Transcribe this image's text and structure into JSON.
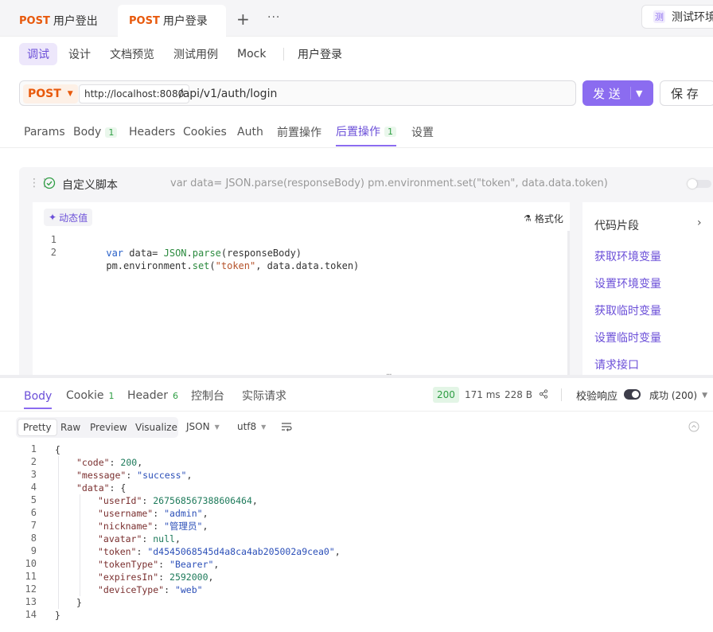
{
  "file_tabs": [
    {
      "method": "POST",
      "label": "用户登出"
    },
    {
      "method": "POST",
      "label": "用户登录"
    }
  ],
  "add_tab_symbol": "+",
  "more_symbol": "···",
  "env": {
    "badge": "测",
    "label": "测试环境"
  },
  "sub_tabs": [
    "调试",
    "设计",
    "文档预览",
    "测试用例",
    "Mock"
  ],
  "endpoint_name": "用户登录",
  "request": {
    "method": "POST",
    "base_url": "http://localhost:8080",
    "path": "/api/v1/auth/login",
    "send_label": "发 送",
    "save_label": "保 存"
  },
  "param_tabs": [
    {
      "label": "Params",
      "count": ""
    },
    {
      "label": "Body",
      "count": "1"
    },
    {
      "label": "Headers",
      "count": ""
    },
    {
      "label": "Cookies",
      "count": ""
    },
    {
      "label": "Auth",
      "count": ""
    },
    {
      "label": "前置操作",
      "count": ""
    },
    {
      "label": "后置操作",
      "count": "1"
    },
    {
      "label": "设置",
      "count": ""
    }
  ],
  "script": {
    "title": "自定义脚本",
    "preview": "var data= JSON.parse(responseBody) pm.environment.set(\"token\", data.data.token)",
    "dynamic_value": "动态值",
    "format": "格式化",
    "line_numbers": [
      "1",
      "2"
    ],
    "lines": [
      [
        "var",
        " data= ",
        "JSON",
        ".",
        "parse",
        "(responseBody)"
      ],
      [
        "",
        "pm.environment.",
        "set",
        "(",
        "\"token\"",
        ", data.data.token)"
      ]
    ],
    "snippets_title": "代码片段",
    "snippets": [
      "获取环境变量",
      "设置环境变量",
      "获取临时变量",
      "设置临时变量",
      "请求接口"
    ]
  },
  "response": {
    "tabs": [
      {
        "label": "Body",
        "count": ""
      },
      {
        "label": "Cookie",
        "count": "1"
      },
      {
        "label": "Header",
        "count": "6"
      },
      {
        "label": "控制台",
        "count": ""
      },
      {
        "label": "实际请求",
        "count": ""
      }
    ],
    "status": "200",
    "time": "171 ms",
    "size": "228 B",
    "validate_label": "校验响应",
    "result_label": "成功 (200)",
    "view_tabs": [
      "Pretty",
      "Raw",
      "Preview",
      "Visualize"
    ],
    "format": "JSON",
    "encoding": "utf8",
    "line_numbers": [
      "1",
      "2",
      "3",
      "4",
      "5",
      "6",
      "7",
      "8",
      "9",
      "10",
      "11",
      "12",
      "13",
      "14"
    ],
    "json_lines": [
      [
        {
          "t": "{",
          "c": "p"
        }
      ],
      [
        {
          "t": "\"code\"",
          "c": "k"
        },
        {
          "t": ": ",
          "c": "p"
        },
        {
          "t": "200",
          "c": "n"
        },
        {
          "t": ",",
          "c": "p"
        }
      ],
      [
        {
          "t": "\"message\"",
          "c": "k"
        },
        {
          "t": ": ",
          "c": "p"
        },
        {
          "t": "\"success\"",
          "c": "s"
        },
        {
          "t": ",",
          "c": "p"
        }
      ],
      [
        {
          "t": "\"data\"",
          "c": "k"
        },
        {
          "t": ": {",
          "c": "p"
        }
      ],
      [
        {
          "t": "\"userId\"",
          "c": "k"
        },
        {
          "t": ": ",
          "c": "p"
        },
        {
          "t": "267568567388606464",
          "c": "n"
        },
        {
          "t": ",",
          "c": "p"
        }
      ],
      [
        {
          "t": "\"username\"",
          "c": "k"
        },
        {
          "t": ": ",
          "c": "p"
        },
        {
          "t": "\"admin\"",
          "c": "s"
        },
        {
          "t": ",",
          "c": "p"
        }
      ],
      [
        {
          "t": "\"nickname\"",
          "c": "k"
        },
        {
          "t": ": ",
          "c": "p"
        },
        {
          "t": "\"管理员\"",
          "c": "s"
        },
        {
          "t": ",",
          "c": "p"
        }
      ],
      [
        {
          "t": "\"avatar\"",
          "c": "k"
        },
        {
          "t": ": ",
          "c": "p"
        },
        {
          "t": "null",
          "c": "n"
        },
        {
          "t": ",",
          "c": "p"
        }
      ],
      [
        {
          "t": "\"token\"",
          "c": "k"
        },
        {
          "t": ": ",
          "c": "p"
        },
        {
          "t": "\"d4545068545d4a8ca4ab205002a9cea0\"",
          "c": "s"
        },
        {
          "t": ",",
          "c": "p"
        }
      ],
      [
        {
          "t": "\"tokenType\"",
          "c": "k"
        },
        {
          "t": ": ",
          "c": "p"
        },
        {
          "t": "\"Bearer\"",
          "c": "s"
        },
        {
          "t": ",",
          "c": "p"
        }
      ],
      [
        {
          "t": "\"expiresIn\"",
          "c": "k"
        },
        {
          "t": ": ",
          "c": "p"
        },
        {
          "t": "2592000",
          "c": "n"
        },
        {
          "t": ",",
          "c": "p"
        }
      ],
      [
        {
          "t": "\"deviceType\"",
          "c": "k"
        },
        {
          "t": ": ",
          "c": "p"
        },
        {
          "t": "\"web\"",
          "c": "s"
        }
      ],
      [
        {
          "t": "}",
          "c": "p"
        }
      ],
      [
        {
          "t": "}",
          "c": "p"
        }
      ]
    ],
    "json_indent": [
      0,
      1,
      1,
      1,
      2,
      2,
      2,
      2,
      2,
      2,
      2,
      2,
      1,
      0
    ]
  },
  "colors": {
    "accent": "#8b6cf0",
    "method": "#e8590c",
    "success": "#2f9e44"
  }
}
